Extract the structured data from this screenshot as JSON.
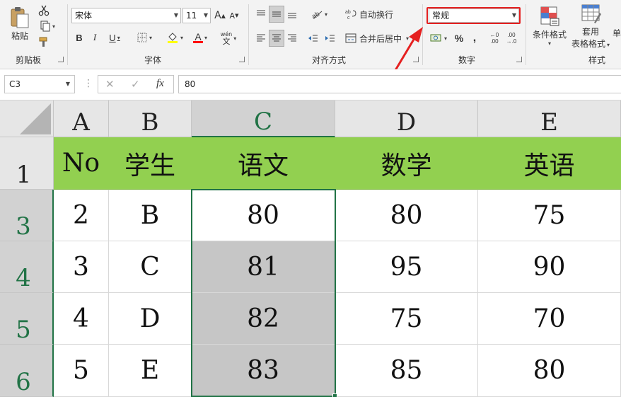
{
  "ribbon": {
    "clipboard": {
      "paste_label": "粘贴",
      "group_label": "剪贴板"
    },
    "font": {
      "font_name": "宋体",
      "font_size": "11",
      "bold": "B",
      "italic": "I",
      "underline": "U",
      "grow_font": "A",
      "shrink_font": "A",
      "font_color_letter": "A",
      "phonetic_label": "wén",
      "phonetic_char": "文",
      "group_label": "字体"
    },
    "alignment": {
      "wrap_text": "自动换行",
      "merge_center": "合并后居中",
      "group_label": "对齐方式"
    },
    "number": {
      "format_value": "常规",
      "percent": "%",
      "comma": ",",
      "inc_decimal_top": "←0",
      "inc_decimal_bottom": ".00",
      "dec_decimal_top": ".00",
      "dec_decimal_bottom": "→.0",
      "group_label": "数字"
    },
    "styles": {
      "conditional_formatting": "条件格式",
      "format_as_table_line1": "套用",
      "format_as_table_line2": "表格格式",
      "cell_styles_partial": "单",
      "group_label": "样式"
    }
  },
  "formula_bar": {
    "name_box": "C3",
    "fx_label": "fx",
    "value": "80"
  },
  "columns": [
    "A",
    "B",
    "C",
    "D",
    "E"
  ],
  "rows": [
    {
      "header": "1",
      "cells": [
        "No",
        "学生",
        "语文",
        "数学",
        "英语"
      ]
    },
    {
      "header": "3",
      "cells": [
        "2",
        "B",
        "80",
        "80",
        "75"
      ]
    },
    {
      "header": "4",
      "cells": [
        "3",
        "C",
        "81",
        "95",
        "90"
      ]
    },
    {
      "header": "5",
      "cells": [
        "4",
        "D",
        "82",
        "75",
        "70"
      ]
    },
    {
      "header": "6",
      "cells": [
        "5",
        "E",
        "83",
        "85",
        "80"
      ]
    }
  ],
  "colors": {
    "header_fill": "#92d050",
    "selection_border": "#217346",
    "selection_fill": "#c6c6c6",
    "annotation": "#e52020"
  }
}
